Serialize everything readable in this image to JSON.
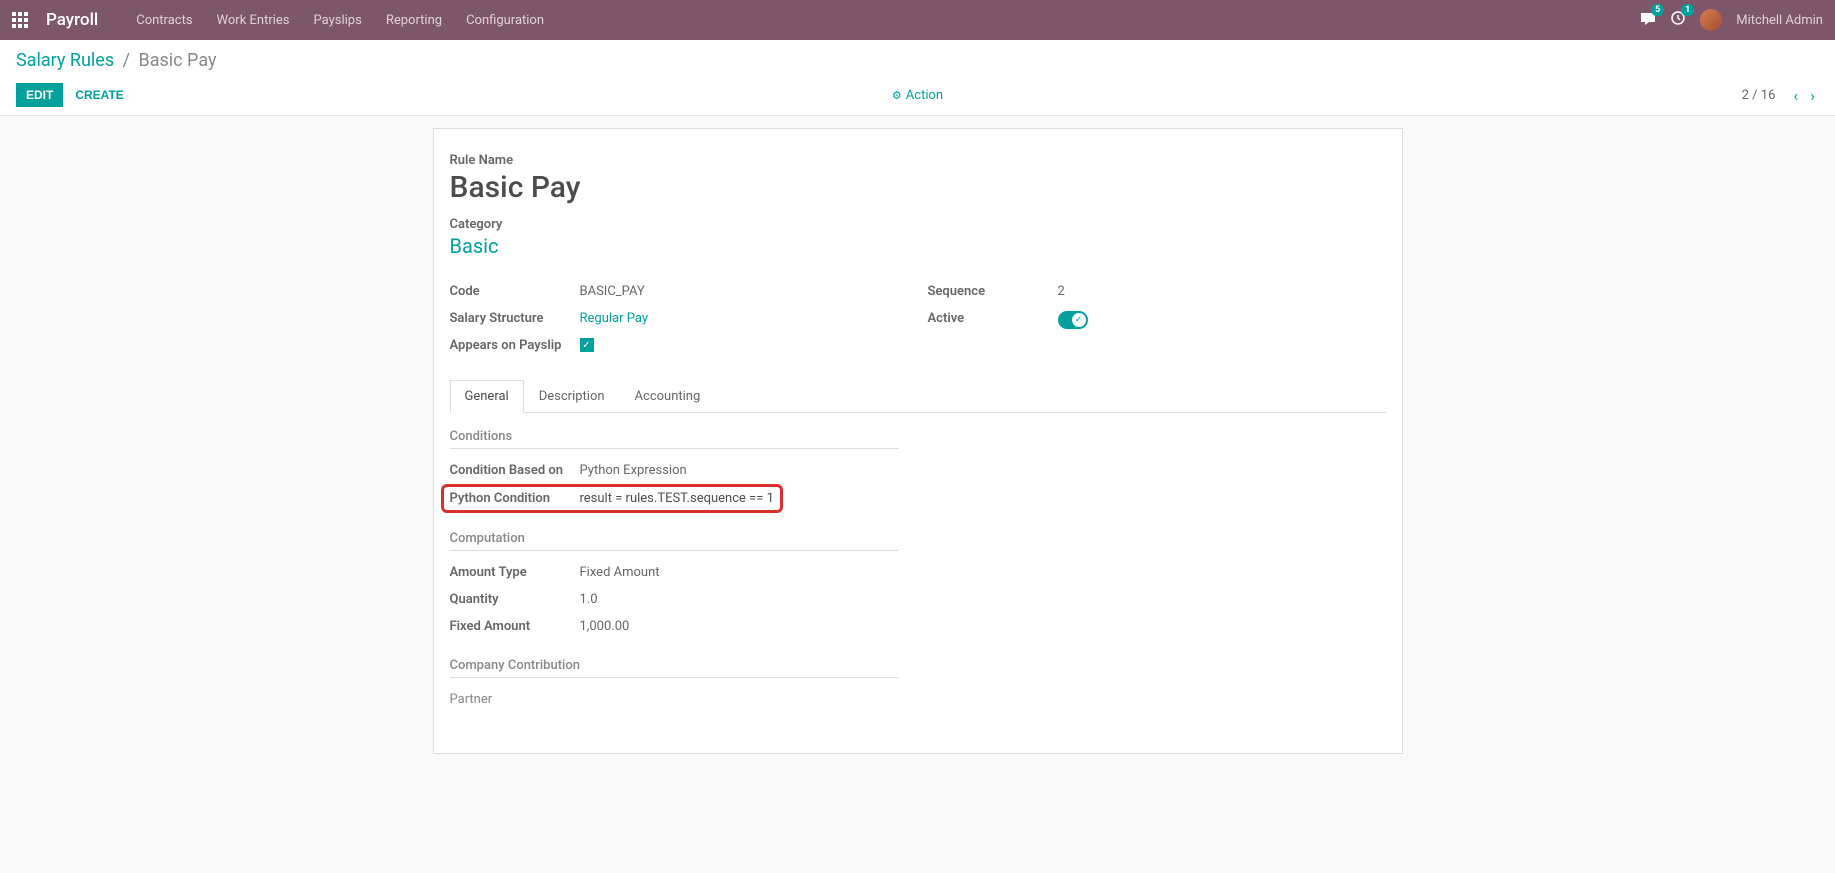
{
  "navbar": {
    "brand": "Payroll",
    "menu": [
      "Contracts",
      "Work Entries",
      "Payslips",
      "Reporting",
      "Configuration"
    ],
    "messages_badge": "5",
    "activities_badge": "1",
    "user": "Mitchell Admin"
  },
  "breadcrumb": {
    "parent": "Salary Rules",
    "current": "Basic Pay"
  },
  "controls": {
    "edit": "EDIT",
    "create": "CREATE",
    "action": "Action",
    "pager": "2 / 16"
  },
  "form": {
    "rule_name_label": "Rule Name",
    "rule_name": "Basic Pay",
    "category_label": "Category",
    "category": "Basic",
    "code_label": "Code",
    "code": "BASIC_PAY",
    "salary_structure_label": "Salary Structure",
    "salary_structure": "Regular Pay",
    "appears_label": "Appears on Payslip",
    "sequence_label": "Sequence",
    "sequence": "2",
    "active_label": "Active"
  },
  "tabs": {
    "general": "General",
    "description": "Description",
    "accounting": "Accounting"
  },
  "sections": {
    "conditions": {
      "title": "Conditions",
      "based_on_label": "Condition Based on",
      "based_on": "Python Expression",
      "python_condition_label": "Python Condition",
      "python_condition": "result = rules.TEST.sequence == 1"
    },
    "computation": {
      "title": "Computation",
      "amount_type_label": "Amount Type",
      "amount_type": "Fixed Amount",
      "quantity_label": "Quantity",
      "quantity": "1.0",
      "fixed_amount_label": "Fixed Amount",
      "fixed_amount": "1,000.00"
    },
    "company": {
      "title": "Company Contribution",
      "partner_label": "Partner"
    }
  }
}
